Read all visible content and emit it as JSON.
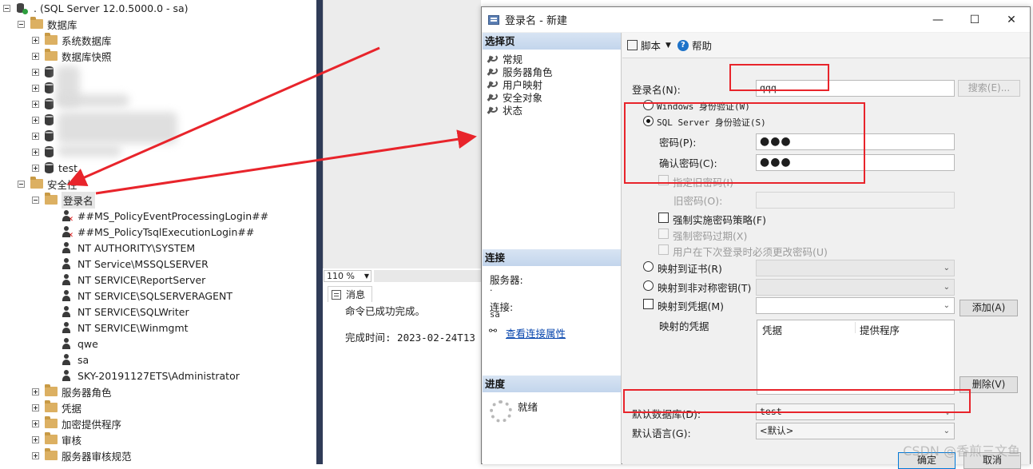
{
  "explorer": {
    "server": ". (SQL Server 12.0.5000.0 - sa)",
    "databases": "数据库",
    "system_databases": "系统数据库",
    "db_snapshots": "数据库快照",
    "test_db": "test",
    "security": "安全性",
    "logins": "登录名",
    "login_items": [
      "##MS_PolicyEventProcessingLogin##",
      "##MS_PolicyTsqlExecutionLogin##",
      "NT AUTHORITY\\SYSTEM",
      "NT Service\\MSSQLSERVER",
      "NT SERVICE\\ReportServer",
      "NT SERVICE\\SQLSERVERAGENT",
      "NT SERVICE\\SQLWriter",
      "NT SERVICE\\Winmgmt",
      "qwe",
      "sa",
      "SKY-20191127ETS\\Administrator"
    ],
    "server_roles": "服务器角色",
    "credentials": "凭据",
    "crypto_providers": "加密提供程序",
    "audits": "审核",
    "audit_specs": "服务器审核规范"
  },
  "query": {
    "zoom": "110 %",
    "messages_tab": "消息",
    "message_line": "命令已成功完成。",
    "completion_line": "完成时间: 2023-02-24T13"
  },
  "dialog": {
    "title": "登录名 - 新建",
    "minimize": "—",
    "maximize": "☐",
    "close": "✕",
    "select_page": "选择页",
    "pages": [
      "常规",
      "服务器角色",
      "用户映射",
      "安全对象",
      "状态"
    ],
    "connection_header": "连接",
    "server_label": "服务器:",
    "server_value": ".",
    "connection_label": "连接:",
    "connection_value": "sa",
    "view_conn_props": "查看连接属性",
    "progress_header": "进度",
    "progress_status": "就绪",
    "toolbar": {
      "script": "脚本",
      "help": "帮助"
    },
    "login_name_label": "登录名(N):",
    "login_name_value": "qqq",
    "search_button": "搜索(E)...",
    "windows_auth": "Windows 身份验证(W)",
    "sql_auth": "SQL Server 身份验证(S)",
    "password_label": "密码(P):",
    "password_value": "●●●",
    "confirm_label": "确认密码(C):",
    "confirm_value": "●●●",
    "specify_old": "指定旧密码(I)",
    "old_password_label": "旧密码(O):",
    "enforce_policy": "强制实施密码策略(F)",
    "enforce_expiry": "强制密码过期(X)",
    "must_change": "用户在下次登录时必须更改密码(U)",
    "map_cert": "映射到证书(R)",
    "map_asym": "映射到非对称密钥(T)",
    "map_cred": "映射到凭据(M)",
    "add_button": "添加(A)",
    "mapped_creds_label": "映射的凭据",
    "col_credential": "凭据",
    "col_provider": "提供程序",
    "remove_button": "删除(V)",
    "default_db_label": "默认数据库(D):",
    "default_db_value": "test",
    "default_lang_label": "默认语言(G):",
    "default_lang_value": "<默认>",
    "ok_button": "确定",
    "cancel_button": "取消"
  },
  "watermark": "CSDN @香煎三文鱼",
  "annotation_color": "#e8242b"
}
